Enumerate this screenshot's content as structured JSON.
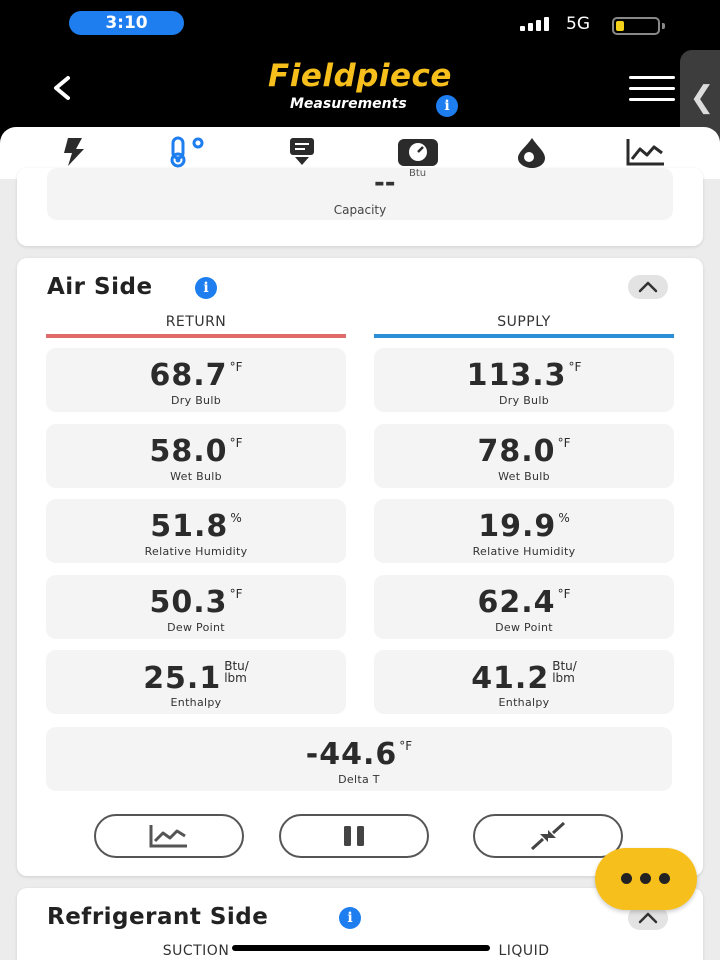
{
  "status_bar": {
    "time": "3:10",
    "network": "5G"
  },
  "header": {
    "logo_text": "Fieldpiece",
    "subtitle": "Measurements",
    "info_glyph": "i",
    "side_tab_glyph": "❮"
  },
  "icon_nav": {
    "items": [
      {
        "name": "electrical",
        "icon": "lightning-icon",
        "active": false
      },
      {
        "name": "temperature",
        "icon": "thermometer-icon",
        "active": true
      },
      {
        "name": "report",
        "icon": "document-download-icon",
        "active": false
      },
      {
        "name": "gauge",
        "icon": "scale-gauge-icon",
        "active": false
      },
      {
        "name": "refrigerant",
        "icon": "flame-drop-icon",
        "active": false
      },
      {
        "name": "trends",
        "icon": "chart-icon",
        "active": false
      }
    ]
  },
  "capacity_card": {
    "value": "--",
    "unit": "Btu",
    "label": "Capacity"
  },
  "air_side": {
    "title": "Air Side",
    "info_glyph": "i",
    "return_heading": "RETURN",
    "supply_heading": "SUPPLY",
    "rows": [
      {
        "label": "Dry Bulb",
        "return": "68.7",
        "supply": "113.3",
        "unit": "°F"
      },
      {
        "label": "Wet Bulb",
        "return": "58.0",
        "supply": "78.0",
        "unit": "°F"
      },
      {
        "label": "Relative Humidity",
        "return": "51.8",
        "supply": "19.9",
        "unit": "%"
      },
      {
        "label": "Dew Point",
        "return": "50.3",
        "supply": "62.4",
        "unit": "°F"
      },
      {
        "label": "Enthalpy",
        "return": "25.1",
        "supply": "41.2",
        "unit_top": "Btu/",
        "unit_bottom": "lbm"
      }
    ],
    "delta": {
      "label": "Delta T",
      "value": "-44.6",
      "unit": "°F"
    },
    "buttons": [
      {
        "name": "graph",
        "icon": "chart-icon"
      },
      {
        "name": "pause",
        "icon": "pause-icon"
      },
      {
        "name": "collapse",
        "icon": "minimize-arrows-icon"
      }
    ]
  },
  "refrigerant_side": {
    "title": "Refrigerant Side",
    "info_glyph": "i",
    "suction_heading": "SUCTION",
    "liquid_heading": "LIQUID"
  },
  "colors": {
    "brand_yellow": "#f7bf1c",
    "accent_blue": "#1e7ef0",
    "return_red": "#e06a6a",
    "supply_blue": "#2a8fd6"
  }
}
